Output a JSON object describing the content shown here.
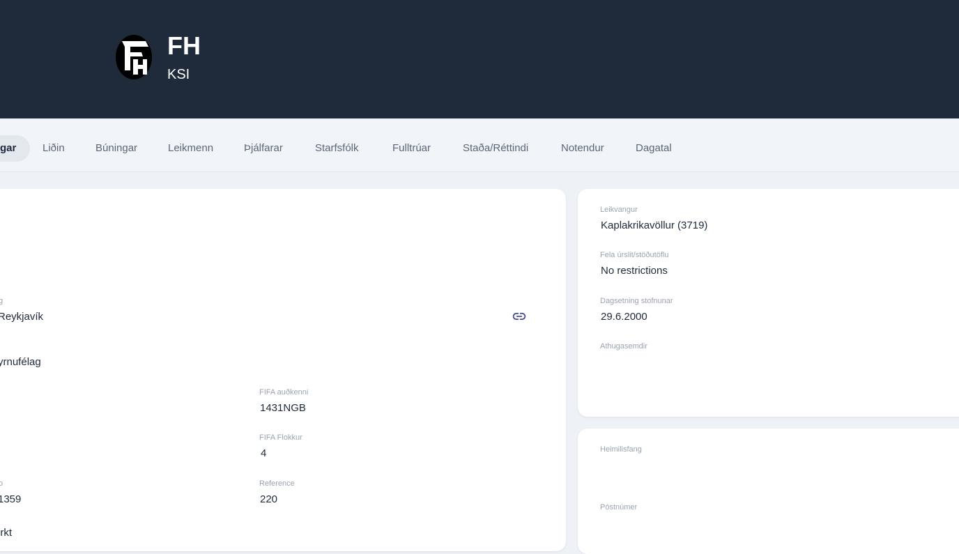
{
  "header": {
    "club_name": "FH",
    "organization": "KSI"
  },
  "tabs": [
    {
      "label": "gar",
      "active": true
    },
    {
      "label": "Liðin",
      "active": false
    },
    {
      "label": "Búningar",
      "active": false
    },
    {
      "label": "Leikmenn",
      "active": false
    },
    {
      "label": "Þjálfarar",
      "active": false
    },
    {
      "label": "Starfsfólk",
      "active": false
    },
    {
      "label": "Fulltrúar",
      "active": false
    },
    {
      "label": "Staða/Réttindi",
      "active": false
    },
    {
      "label": "Notendur",
      "active": false
    },
    {
      "label": "Dagatal",
      "active": false
    }
  ],
  "details_left": {
    "field_1": {
      "label": "g",
      "value": "Reykjavík"
    },
    "field_2": {
      "value": "yrnufélag"
    },
    "fifa_id": {
      "label": "FIFA auðkenni",
      "value": "1431NGB"
    },
    "fifa_category": {
      "label": "FIFA Flokkur",
      "value": "4"
    },
    "field_3": {
      "label": "o",
      "value": "1359"
    },
    "reference": {
      "label": "Reference",
      "value": "220"
    },
    "field_4": {
      "value": "irkt"
    }
  },
  "details_right": {
    "stadium": {
      "label": "Leikvangur",
      "value": "Kaplakrikavöllur (3719)"
    },
    "hide_results": {
      "label": "Fela úrslit/stöðutöflu",
      "value": "No restrictions"
    },
    "founding_date": {
      "label": "Dagsetning stofnunar",
      "value": "29.6.2000"
    },
    "notes": {
      "label": "Athugasemdir",
      "value": ""
    }
  },
  "address": {
    "home_address": {
      "label": "Heimilisfang",
      "value": ""
    },
    "postal_code": {
      "label": "Póstnúmer",
      "value": ""
    }
  },
  "icons": {
    "logo": "club-crest",
    "link": "link-icon"
  },
  "colors": {
    "header_bg": "#1f2a3b",
    "page_bg": "#eef2f6",
    "accent": "#4a4f8a"
  }
}
